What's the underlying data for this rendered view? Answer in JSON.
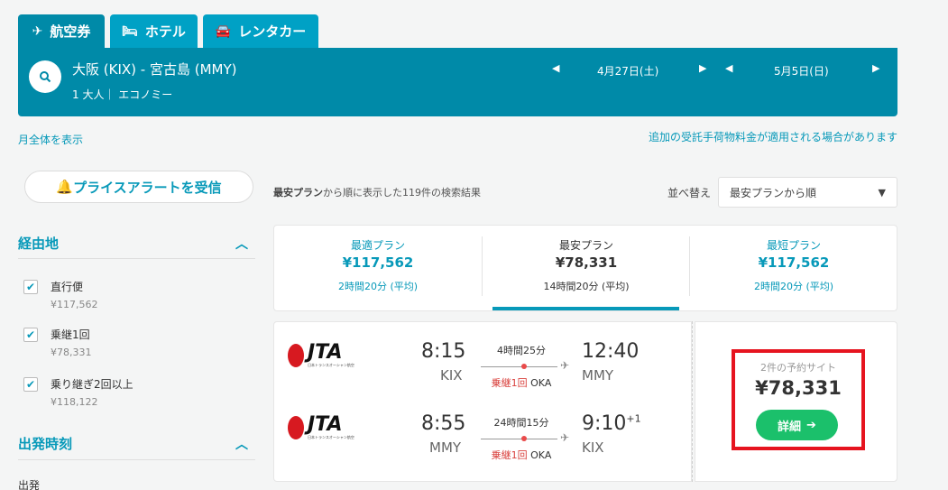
{
  "tabs": [
    {
      "label": "航空券",
      "icon": "plane-icon"
    },
    {
      "label": "ホテル",
      "icon": "bed-icon"
    },
    {
      "label": "レンタカー",
      "icon": "car-icon"
    }
  ],
  "search": {
    "route": "大阪 (KIX) - 宮古島 (MMY)",
    "passengers": "1 大人｜ エコノミー",
    "depart_date": "4月27日(土)",
    "return_date": "5月5日(日)"
  },
  "links": {
    "month_view": "月全体を表示",
    "baggage_notice": "追加の受託手荷物料金が適用される場合があります"
  },
  "price_alert": "プライスアラートを受信",
  "filters": {
    "stops_title": "経由地",
    "stops": [
      {
        "label": "直行便",
        "price": "¥117,562",
        "checked": true
      },
      {
        "label": "乗継1回",
        "price": "¥78,331",
        "checked": true
      },
      {
        "label": "乗り継ぎ2回以上",
        "price": "¥118,122",
        "checked": true
      }
    ],
    "departure_title": "出発時刻",
    "departure_sub": "出発"
  },
  "results": {
    "prefix": "最安プラン",
    "suffix": "から順に表示した119件の検索結果",
    "sort_label": "並べ替え",
    "sort_value": "最安プランから順"
  },
  "plans": [
    {
      "name": "最適プラン",
      "price": "¥117,562",
      "time": "2時間20分 (平均)"
    },
    {
      "name": "最安プラン",
      "price": "¥78,331",
      "time": "14時間20分 (平均)"
    },
    {
      "name": "最短プラン",
      "price": "¥117,562",
      "time": "2時間20分 (平均)"
    }
  ],
  "flight": {
    "airline": "JTA",
    "airline_sub": "日本トランスオーシャン航空",
    "outbound": {
      "dep_time": "8:15",
      "dep_code": "KIX",
      "duration": "4時間25分",
      "arr_time": "12:40",
      "arr_code": "MMY",
      "stop_label": "乗継1回",
      "stop_code": "OKA"
    },
    "inbound": {
      "dep_time": "8:55",
      "dep_code": "MMY",
      "duration": "24時間15分",
      "arr_time": "9:10",
      "day_offset": "+1",
      "arr_code": "KIX",
      "stop_label": "乗継1回",
      "stop_code": "OKA"
    },
    "sites": "2件の予約サイト",
    "price": "¥78,331",
    "detail_label": "詳細"
  },
  "colors": {
    "teal": "#008aa8",
    "accent": "#0799b9",
    "green": "#1bc06b",
    "highlight": "#e6141f"
  }
}
